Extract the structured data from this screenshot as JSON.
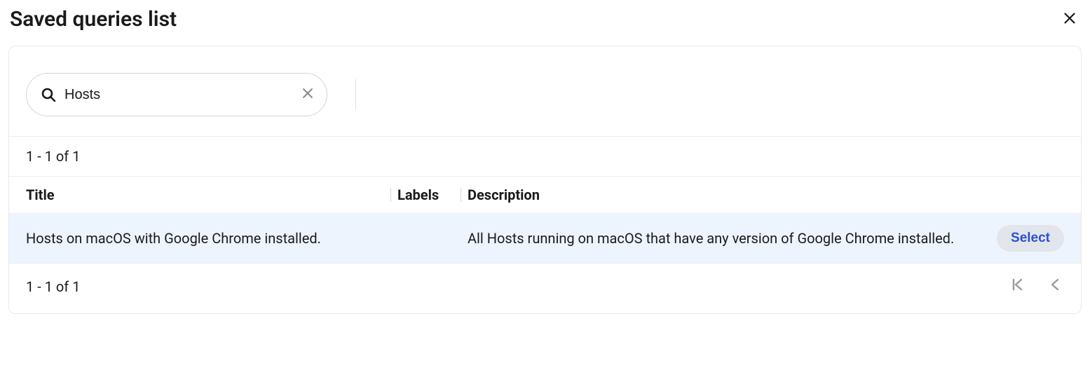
{
  "header": {
    "title": "Saved queries list"
  },
  "search": {
    "value": "Hosts",
    "placeholder": "Search"
  },
  "pagination": {
    "top_text": "1 - 1 of 1",
    "bottom_text": "1 - 1 of 1"
  },
  "table": {
    "columns": {
      "title": "Title",
      "labels": "Labels",
      "description": "Description"
    },
    "rows": [
      {
        "title": "Hosts on macOS with Google Chrome installed.",
        "labels": "",
        "description": "All Hosts running on macOS that have any version of Google Chrome installed.",
        "action_label": "Select"
      }
    ]
  }
}
